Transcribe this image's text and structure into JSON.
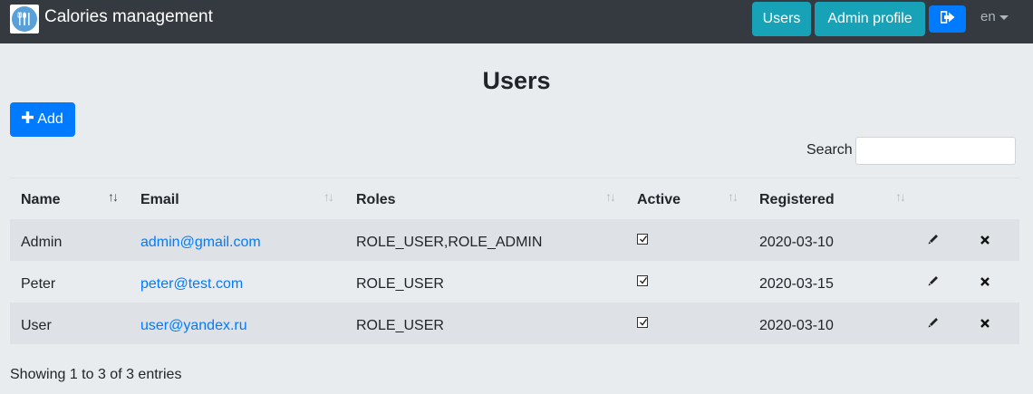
{
  "navbar": {
    "brand": "Calories management",
    "users_label": "Users",
    "profile_label": "Admin profile",
    "lang": "en"
  },
  "page": {
    "title": "Users",
    "add_label": "Add",
    "search_label": "Search",
    "search_value": ""
  },
  "table": {
    "columns": [
      "Name",
      "Email",
      "Roles",
      "Active",
      "Registered"
    ],
    "rows": [
      {
        "name": "Admin",
        "email": "admin@gmail.com",
        "roles": "ROLE_USER,ROLE_ADMIN",
        "active": true,
        "registered": "2020-03-10"
      },
      {
        "name": "Peter",
        "email": "peter@test.com",
        "roles": "ROLE_USER",
        "active": true,
        "registered": "2020-03-15"
      },
      {
        "name": "User",
        "email": "user@yandex.ru",
        "roles": "ROLE_USER",
        "active": true,
        "registered": "2020-03-10"
      }
    ]
  },
  "footer": {
    "info": "Showing 1 to 3 of 3 entries"
  },
  "colors": {
    "navbar": "#343a40",
    "info": "#17a2b8",
    "primary": "#007bff",
    "background": "#e9ecef"
  }
}
